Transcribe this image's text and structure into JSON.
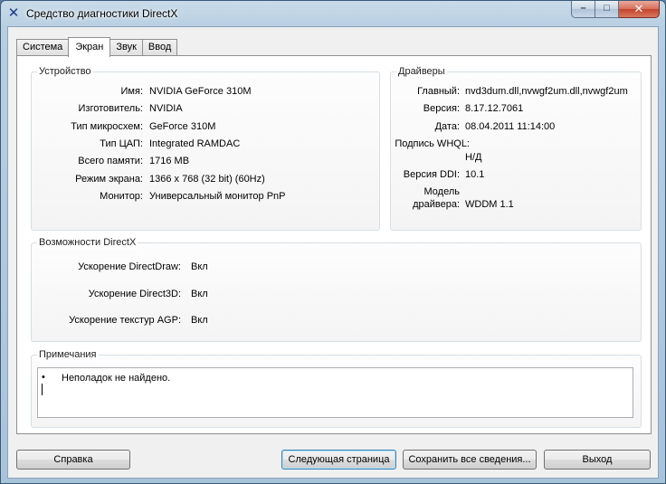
{
  "window": {
    "title": "Средство диагностики DirectX",
    "icon": "directx-x-icon",
    "close_glyph": "✕",
    "max_glyph": "□",
    "min_glyph": "–"
  },
  "tabs": [
    {
      "label": "Система",
      "active": false
    },
    {
      "label": "Экран",
      "active": true
    },
    {
      "label": "Звук",
      "active": false
    },
    {
      "label": "Ввод",
      "active": false
    }
  ],
  "device": {
    "title": "Устройство",
    "rows": [
      {
        "label": "Имя:",
        "value": "NVIDIA GeForce 310M"
      },
      {
        "label": "Изготовитель:",
        "value": "NVIDIA"
      },
      {
        "label": "Тип микросхем:",
        "value": "GeForce 310M"
      },
      {
        "label": "Тип ЦАП:",
        "value": "Integrated RAMDAC"
      },
      {
        "label": "Всего памяти:",
        "value": "1716 MB"
      },
      {
        "label": "Режим экрана:",
        "value": "1366 x 768 (32 bit) (60Hz)"
      },
      {
        "label": "Монитор:",
        "value": "Универсальный монитор PnP"
      }
    ]
  },
  "drivers": {
    "title": "Драйверы",
    "main_label": "Главный:",
    "main_value": "nvd3dum.dll,nvwgf2um.dll,nvwgf2um",
    "version_label": "Версия:",
    "version_value": "8.17.12.7061",
    "date_label": "Дата:",
    "date_value": "08.04.2011 11:14:00",
    "whql_label": "Подпись WHQL:",
    "whql_value": "Н/Д",
    "ddi_label": "Версия DDI:",
    "ddi_value": "10.1",
    "model_label_1": "Модель",
    "model_label_2": "драйвера:",
    "model_value": "WDDM 1.1"
  },
  "features": {
    "title": "Возможности DirectX",
    "rows": [
      {
        "label": "Ускорение DirectDraw:",
        "value": "Вкл"
      },
      {
        "label": "Ускорение Direct3D:",
        "value": "Вкл"
      },
      {
        "label": "Ускорение текстур AGP:",
        "value": "Вкл"
      }
    ]
  },
  "notes": {
    "title": "Примечания",
    "bullet": "•",
    "text": "Неполадок не найдено."
  },
  "buttons": {
    "help": "Справка",
    "next_page": "Следующая страница",
    "save_all": "Сохранить все сведения...",
    "exit": "Выход"
  }
}
